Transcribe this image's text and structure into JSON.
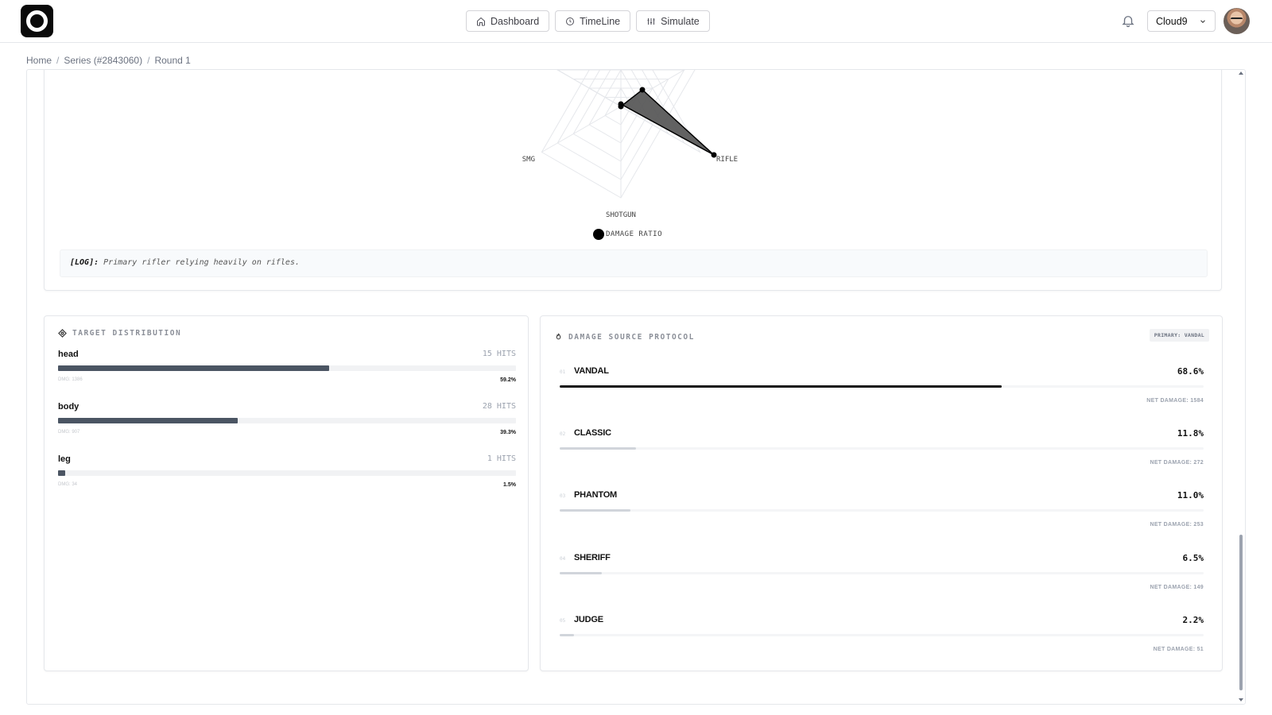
{
  "nav": {
    "items": [
      {
        "label": "Dashboard",
        "icon": "home-icon"
      },
      {
        "label": "TimeLine",
        "icon": "clock-icon"
      },
      {
        "label": "Simulate",
        "icon": "sliders-icon"
      }
    ],
    "team": "Cloud9"
  },
  "breadcrumb": [
    "Home",
    "Series (#2843060)",
    "Round 1"
  ],
  "chart_data": {
    "type": "radar",
    "axes": [
      "SMG",
      "RIFLE",
      "SHOTGUN"
    ],
    "series": [
      {
        "name": "DAMAGE RATIO"
      }
    ],
    "color": "#000000"
  },
  "log": {
    "tag": "[LOG]:",
    "text": "Primary rifler relying heavily on rifles."
  },
  "target": {
    "title": "TARGET DISTRIBUTION",
    "rows": [
      {
        "zone": "head",
        "hits": "15 HITS",
        "dmg": "DMG: 1386",
        "pct": "59.2%",
        "ratio": 0.592
      },
      {
        "zone": "body",
        "hits": "28 HITS",
        "dmg": "DMG: 907",
        "pct": "39.3%",
        "ratio": 0.393
      },
      {
        "zone": "leg",
        "hits": "1 HITS",
        "dmg": "DMG: 34",
        "pct": "1.5%",
        "ratio": 0.015
      }
    ]
  },
  "damage": {
    "title": "DAMAGE SOURCE PROTOCOL",
    "badge": "PRIMARY: VANDAL",
    "weapons": [
      {
        "idx": "01",
        "name": "VANDAL",
        "pct": "68.6%",
        "ratio": 0.686,
        "net": "NET DAMAGE: 1584"
      },
      {
        "idx": "02",
        "name": "CLASSIC",
        "pct": "11.8%",
        "ratio": 0.118,
        "net": "NET DAMAGE: 272"
      },
      {
        "idx": "03",
        "name": "PHANTOM",
        "pct": "11.0%",
        "ratio": 0.11,
        "net": "NET DAMAGE: 253"
      },
      {
        "idx": "04",
        "name": "SHERIFF",
        "pct": "6.5%",
        "ratio": 0.065,
        "net": "NET DAMAGE: 149"
      },
      {
        "idx": "05",
        "name": "JUDGE",
        "pct": "2.2%",
        "ratio": 0.022,
        "net": "NET DAMAGE: 51"
      }
    ]
  }
}
